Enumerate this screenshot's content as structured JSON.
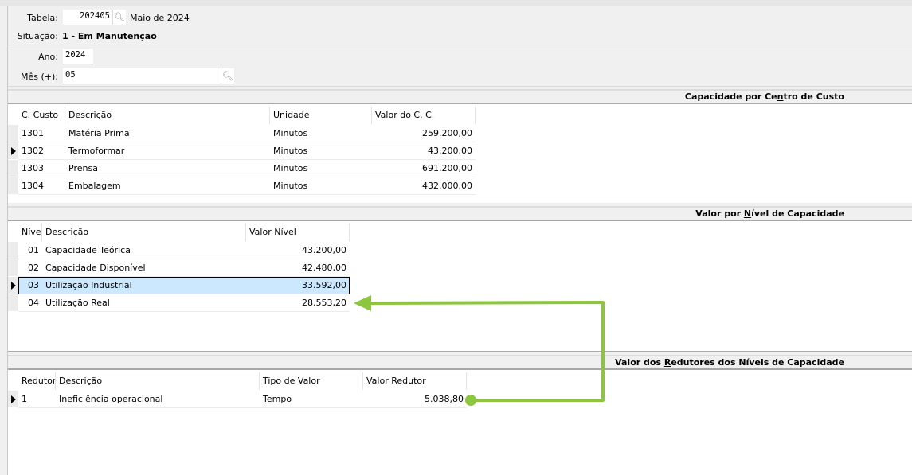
{
  "form": {
    "tabela_label": "Tabela:",
    "tabela_value": "202405",
    "tabela_desc": "Maio de 2024",
    "situacao_label": "Situação:",
    "situacao_value": "1 - Em Manutenção",
    "ano_label": "Ano:",
    "ano_value": "2024",
    "mes_label": "Mês (+):",
    "mes_value": "05"
  },
  "sec1": {
    "title_pre": "Capacidade por Ce",
    "title_key": "n",
    "title_post": "tro de Custo",
    "columns": [
      "C. Custo",
      "Descrição",
      "Unidade",
      "Valor do C. C."
    ],
    "rows": [
      [
        "1301",
        "Matéria Prima",
        "Minutos",
        "259.200,00"
      ],
      [
        "1302",
        "Termoformar",
        "Minutos",
        "43.200,00"
      ],
      [
        "1303",
        "Prensa",
        "Minutos",
        "691.200,00"
      ],
      [
        "1304",
        "Embalagem",
        "Minutos",
        "432.000,00"
      ]
    ],
    "current_row": 1
  },
  "sec2": {
    "title_pre": "Valor por ",
    "title_key": "N",
    "title_post": "ível de Capacidade",
    "columns": [
      "Nível",
      "Descrição",
      "Valor Nível"
    ],
    "rows": [
      [
        "01",
        "Capacidade Teórica",
        "43.200,00"
      ],
      [
        "02",
        "Capacidade Disponível",
        "42.480,00"
      ],
      [
        "03",
        "Utilização Industrial",
        "33.592,00"
      ],
      [
        "04",
        "Utilização Real",
        "28.553,20"
      ]
    ],
    "current_row": 2
  },
  "sec3": {
    "title_pre": "Valor dos ",
    "title_key": "R",
    "title_post": "edutores dos Níveis de Capacidade",
    "columns": [
      "Redutor",
      "Descrição",
      "Tipo de Valor",
      "Valor Redutor"
    ],
    "rows": [
      [
        "1",
        "Ineficiência operacional",
        "Tempo",
        "5.038,80"
      ]
    ],
    "current_row": 0
  },
  "annotation": {
    "arrow_color": "#8cc63f"
  }
}
